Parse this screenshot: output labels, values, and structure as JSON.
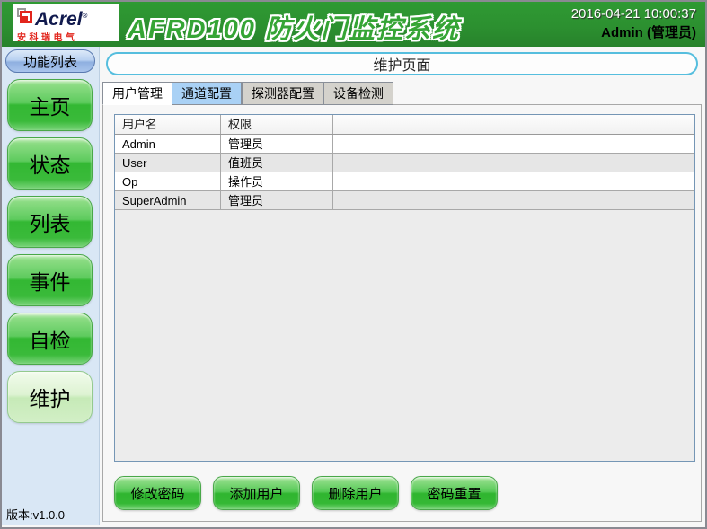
{
  "header": {
    "logo": {
      "brand": "Acrel",
      "trademark": "®",
      "chinese": "安科瑞电气"
    },
    "title": "AFRD100 防火门监控系统",
    "datetime": "2016-04-21 10:00:37",
    "user": "Admin (管理员)"
  },
  "sidebar": {
    "header_label": "功能列表",
    "items": [
      {
        "label": "主页",
        "selected": false
      },
      {
        "label": "状态",
        "selected": false
      },
      {
        "label": "列表",
        "selected": false
      },
      {
        "label": "事件",
        "selected": false
      },
      {
        "label": "自检",
        "selected": false
      },
      {
        "label": "维护",
        "selected": true
      }
    ],
    "version": "版本:v1.0.0"
  },
  "main": {
    "page_title": "维护页面",
    "tabs": [
      {
        "label": "用户管理",
        "state": "active"
      },
      {
        "label": "通道配置",
        "state": "highlight"
      },
      {
        "label": "探测器配置",
        "state": "normal"
      },
      {
        "label": "设备检测",
        "state": "normal"
      }
    ],
    "table": {
      "columns": [
        "用户名",
        "权限"
      ],
      "rows": [
        {
          "username": "Admin",
          "role": "管理员"
        },
        {
          "username": "User",
          "role": "值班员"
        },
        {
          "username": "Op",
          "role": "操作员"
        },
        {
          "username": "SuperAdmin",
          "role": "管理员"
        }
      ]
    },
    "buttons": [
      {
        "label": "修改密码"
      },
      {
        "label": "添加用户"
      },
      {
        "label": "删除用户"
      },
      {
        "label": "密码重置"
      }
    ]
  },
  "colors": {
    "header_green": "#2d9231",
    "sidebar_bg": "#d9e7f5",
    "title_border_cyan": "#56bede",
    "button_green": "#35b835",
    "tab_highlight_blue": "#a9d1f5",
    "table_border_blue": "#7596b5"
  }
}
